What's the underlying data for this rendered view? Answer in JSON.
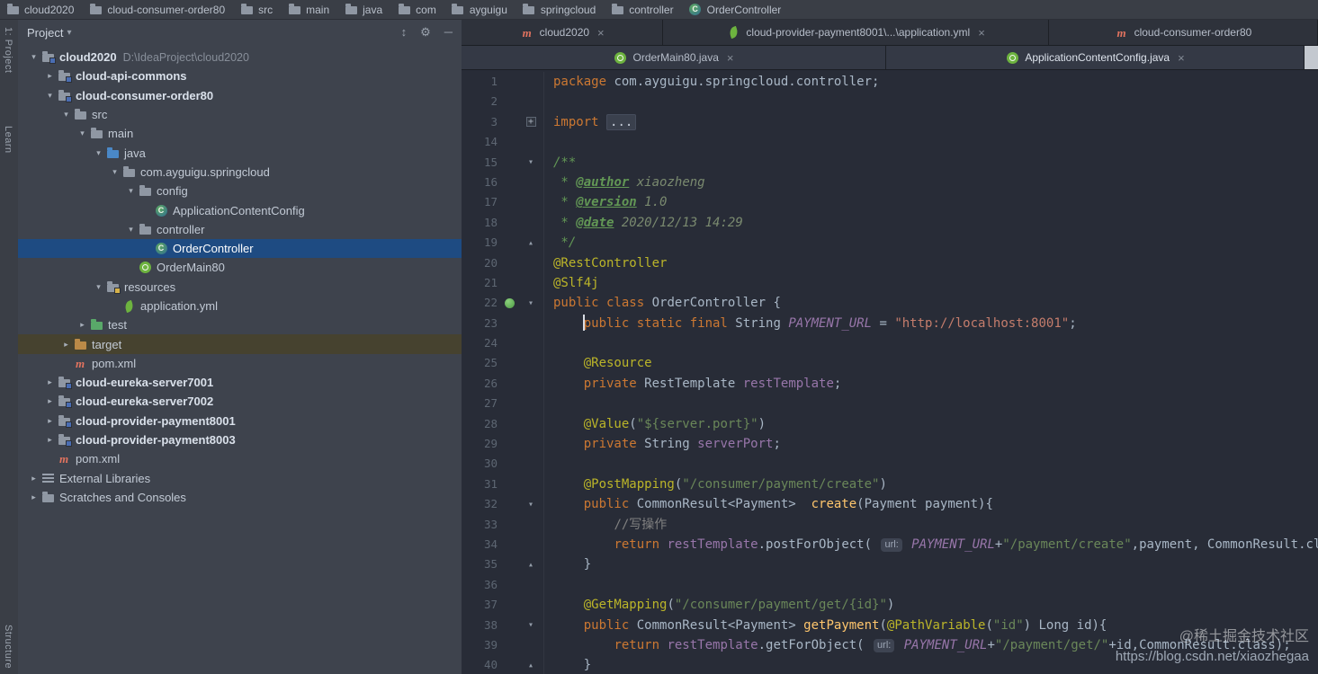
{
  "stripe": {
    "items": [
      "1: Project",
      "Learn",
      "Structure"
    ]
  },
  "breadcrumbs": {
    "items": [
      {
        "label": "cloud2020",
        "icon": "folder"
      },
      {
        "label": "cloud-consumer-order80",
        "icon": "folder"
      },
      {
        "label": "src",
        "icon": "folder"
      },
      {
        "label": "main",
        "icon": "folder"
      },
      {
        "label": "java",
        "icon": "folder"
      },
      {
        "label": "com",
        "icon": "folder"
      },
      {
        "label": "ayguigu",
        "icon": "folder"
      },
      {
        "label": "springcloud",
        "icon": "folder"
      },
      {
        "label": "controller",
        "icon": "folder"
      },
      {
        "label": "OrderController",
        "icon": "class"
      }
    ]
  },
  "project_panel": {
    "title": "Project",
    "header_icons": [
      {
        "name": "collapse-all-icon",
        "glyph": "↕"
      },
      {
        "name": "settings-gear-icon",
        "glyph": "⚙"
      },
      {
        "name": "hide-panel-icon",
        "glyph": "─"
      }
    ],
    "tree": [
      {
        "label": "cloud2020",
        "suffix": "D:\\IdeaProject\\cloud2020",
        "level": 0,
        "icon": "module",
        "arrow": "open",
        "bold": true
      },
      {
        "label": "cloud-api-commons",
        "level": 1,
        "icon": "module",
        "arrow": "closed",
        "bold": true
      },
      {
        "label": "cloud-consumer-order80",
        "level": 1,
        "icon": "module",
        "arrow": "open",
        "bold": true
      },
      {
        "label": "src",
        "level": 2,
        "icon": "folder",
        "arrow": "open"
      },
      {
        "label": "main",
        "level": 3,
        "icon": "folder",
        "arrow": "open"
      },
      {
        "label": "java",
        "level": 4,
        "icon": "folder-blue",
        "arrow": "open"
      },
      {
        "label": "com.ayguigu.springcloud",
        "level": 5,
        "icon": "folder",
        "arrow": "open"
      },
      {
        "label": "config",
        "level": 6,
        "icon": "folder",
        "arrow": "open"
      },
      {
        "label": "ApplicationContentConfig",
        "level": 7,
        "icon": "class"
      },
      {
        "label": "controller",
        "level": 6,
        "icon": "folder",
        "arrow": "open"
      },
      {
        "label": "OrderController",
        "level": 7,
        "icon": "class",
        "selected": true
      },
      {
        "label": "OrderMain80",
        "level": 6,
        "icon": "class-boot"
      },
      {
        "label": "resources",
        "level": 4,
        "icon": "folder-res",
        "arrow": "open"
      },
      {
        "label": "application.yml",
        "level": 5,
        "icon": "spring-yml"
      },
      {
        "label": "test",
        "level": 3,
        "icon": "folder-green",
        "arrow": "closed"
      },
      {
        "label": "target",
        "level": 2,
        "icon": "folder-excluded",
        "arrow": "closed",
        "hl": true
      },
      {
        "label": "pom.xml",
        "level": 2,
        "icon": "maven"
      },
      {
        "label": "cloud-eureka-server7001",
        "level": 1,
        "icon": "module",
        "arrow": "closed",
        "bold": true
      },
      {
        "label": "cloud-eureka-server7002",
        "level": 1,
        "icon": "module",
        "arrow": "closed",
        "bold": true
      },
      {
        "label": "cloud-provider-payment8001",
        "level": 1,
        "icon": "module",
        "arrow": "closed",
        "bold": true
      },
      {
        "label": "cloud-provider-payment8003",
        "level": 1,
        "icon": "module",
        "arrow": "closed",
        "bold": true
      },
      {
        "label": "pom.xml",
        "level": 1,
        "icon": "maven"
      },
      {
        "label": "External Libraries",
        "level": 0,
        "icon": "library",
        "arrow": "closed"
      },
      {
        "label": "Scratches and Consoles",
        "level": 0,
        "icon": "folder",
        "arrow": "closed"
      }
    ]
  },
  "editor": {
    "tab_rows": [
      {
        "tabs": [
          {
            "label": "cloud2020",
            "icon": "maven",
            "close": true
          },
          {
            "label": "cloud-provider-payment8001\\...\\application.yml",
            "icon": "spring-yml",
            "close": true
          },
          {
            "label": "cloud-consumer-order80",
            "icon": "maven",
            "close": false
          }
        ]
      },
      {
        "tabs": [
          {
            "label": "OrderMain80.java",
            "icon": "class-boot",
            "close": true
          },
          {
            "label": "ApplicationContentConfig.java",
            "icon": "class-boot",
            "close": true,
            "active": true
          }
        ],
        "thumb": true
      }
    ],
    "lines": [
      {
        "n": "1",
        "t": [
          [
            "kw",
            "package"
          ],
          [
            "def",
            " com.ayguigu.springcloud.controller;"
          ]
        ]
      },
      {
        "n": "2",
        "t": []
      },
      {
        "n": "3",
        "fold": "plus",
        "t": [
          [
            "kw",
            "import"
          ],
          [
            "def",
            " "
          ],
          [
            "fold",
            "..."
          ]
        ]
      },
      {
        "n": "14",
        "t": []
      },
      {
        "n": "15",
        "fold": "down",
        "t": [
          [
            "doc",
            "/**"
          ]
        ]
      },
      {
        "n": "16",
        "t": [
          [
            "doc",
            " * "
          ],
          [
            "doctag",
            "@author"
          ],
          [
            "docval",
            " xiaozheng"
          ]
        ]
      },
      {
        "n": "17",
        "t": [
          [
            "doc",
            " * "
          ],
          [
            "doctag",
            "@version"
          ],
          [
            "docval",
            " 1.0"
          ]
        ]
      },
      {
        "n": "18",
        "t": [
          [
            "doc",
            " * "
          ],
          [
            "doctag",
            "@date"
          ],
          [
            "docval",
            " 2020/12/13 14:29"
          ]
        ]
      },
      {
        "n": "19",
        "fold": "up",
        "t": [
          [
            "doc",
            " */"
          ]
        ]
      },
      {
        "n": "20",
        "t": [
          [
            "ann",
            "@RestController"
          ]
        ]
      },
      {
        "n": "21",
        "t": [
          [
            "ann",
            "@Slf4j"
          ]
        ]
      },
      {
        "n": "22",
        "fold": "down",
        "gicon": "spring",
        "t": [
          [
            "kw",
            "public class"
          ],
          [
            "def",
            " OrderController {"
          ]
        ]
      },
      {
        "n": "23",
        "t": [
          [
            "def",
            "    "
          ],
          [
            "kw",
            "public static final"
          ],
          [
            "def",
            " String "
          ],
          [
            "cnst",
            "PAYMENT_URL"
          ],
          [
            "def",
            " = "
          ],
          [
            "strp",
            "\"http://localhost:8001\""
          ],
          [
            "def",
            ";"
          ]
        ]
      },
      {
        "n": "24",
        "t": []
      },
      {
        "n": "25",
        "t": [
          [
            "def",
            "    "
          ],
          [
            "ann",
            "@Resource"
          ]
        ]
      },
      {
        "n": "26",
        "t": [
          [
            "def",
            "    "
          ],
          [
            "kw",
            "private"
          ],
          [
            "def",
            " RestTemplate "
          ],
          [
            "fld",
            "restTemplate"
          ],
          [
            "def",
            ";"
          ]
        ]
      },
      {
        "n": "27",
        "t": []
      },
      {
        "n": "28",
        "t": [
          [
            "def",
            "    "
          ],
          [
            "ann",
            "@Value"
          ],
          [
            "def",
            "("
          ],
          [
            "str",
            "\"${server.port}\""
          ],
          [
            "def",
            ")"
          ]
        ]
      },
      {
        "n": "29",
        "t": [
          [
            "def",
            "    "
          ],
          [
            "kw",
            "private"
          ],
          [
            "def",
            " String "
          ],
          [
            "fld",
            "serverPort"
          ],
          [
            "def",
            ";"
          ]
        ]
      },
      {
        "n": "30",
        "t": []
      },
      {
        "n": "31",
        "t": [
          [
            "def",
            "    "
          ],
          [
            "ann",
            "@PostMapping"
          ],
          [
            "def",
            "("
          ],
          [
            "str",
            "\"/consumer/payment/create\""
          ],
          [
            "def",
            ")"
          ]
        ]
      },
      {
        "n": "32",
        "fold": "down",
        "t": [
          [
            "def",
            "    "
          ],
          [
            "kw",
            "public"
          ],
          [
            "def",
            " CommonResult<Payment>  "
          ],
          [
            "mth",
            "create"
          ],
          [
            "def",
            "(Payment payment){"
          ]
        ]
      },
      {
        "n": "33",
        "t": [
          [
            "def",
            "        "
          ],
          [
            "cmt",
            "//写操作"
          ]
        ]
      },
      {
        "n": "34",
        "t": [
          [
            "def",
            "        "
          ],
          [
            "kw",
            "return"
          ],
          [
            "def",
            " "
          ],
          [
            "fld",
            "restTemplate"
          ],
          [
            "def",
            ".postForObject( "
          ],
          [
            "inlay",
            "url:"
          ],
          [
            "cnst",
            " PAYMENT_URL"
          ],
          [
            "def",
            "+"
          ],
          [
            "str",
            "\"/payment/create\""
          ],
          [
            "def",
            ",payment, CommonResult.class);"
          ]
        ]
      },
      {
        "n": "35",
        "fold": "up",
        "t": [
          [
            "def",
            "    }"
          ]
        ]
      },
      {
        "n": "36",
        "t": []
      },
      {
        "n": "37",
        "t": [
          [
            "def",
            "    "
          ],
          [
            "ann",
            "@GetMapping"
          ],
          [
            "def",
            "("
          ],
          [
            "str",
            "\"/consumer/payment/get/{id}\""
          ],
          [
            "def",
            ")"
          ]
        ]
      },
      {
        "n": "38",
        "fold": "down",
        "t": [
          [
            "def",
            "    "
          ],
          [
            "kw",
            "public"
          ],
          [
            "def",
            " CommonResult<Payment> "
          ],
          [
            "mth",
            "getPayment"
          ],
          [
            "def",
            "("
          ],
          [
            "ann",
            "@PathVariable"
          ],
          [
            "def",
            "("
          ],
          [
            "str",
            "\"id\""
          ],
          [
            "def",
            ") Long id){"
          ]
        ]
      },
      {
        "n": "39",
        "t": [
          [
            "def",
            "        "
          ],
          [
            "kw",
            "return"
          ],
          [
            "def",
            " "
          ],
          [
            "fld",
            "restTemplate"
          ],
          [
            "def",
            ".getForObject( "
          ],
          [
            "inlay",
            "url:"
          ],
          [
            "cnst",
            " PAYMENT_URL"
          ],
          [
            "def",
            "+"
          ],
          [
            "str",
            "\"/payment/get/\""
          ],
          [
            "def",
            "+id,CommonResult.class);"
          ]
        ]
      },
      {
        "n": "40",
        "fold": "up",
        "t": [
          [
            "def",
            "    }"
          ]
        ]
      }
    ]
  },
  "watermark": {
    "line1": "@稀土掘金技术社区",
    "line2": "https://blog.csdn.net/xiaozhegaa"
  },
  "colors": {
    "selection_blue": "#1e4b82",
    "spring_green": "#6db33f",
    "keyword_orange": "#cc7832",
    "string_green": "#6a8759",
    "annotation_yellow": "#bbb529",
    "field_purple": "#9876aa",
    "editor_bg": "#282c37"
  }
}
